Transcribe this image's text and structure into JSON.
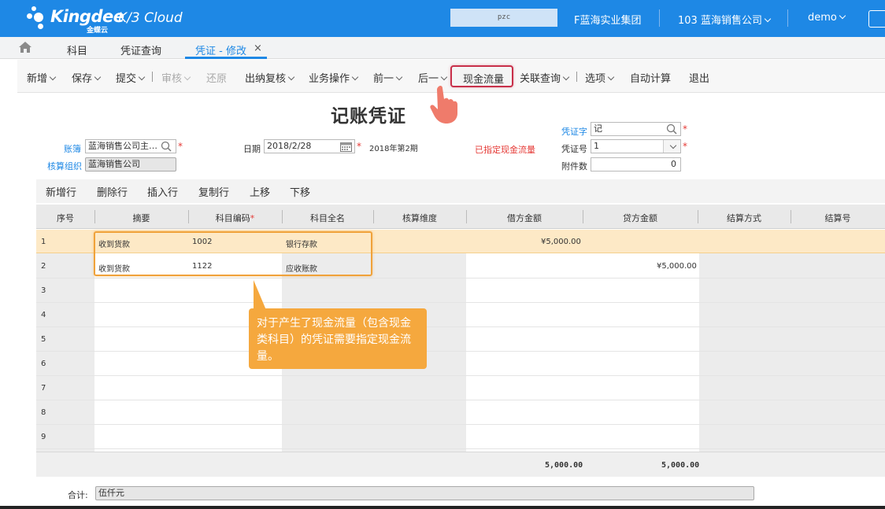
{
  "header": {
    "brand": "Kingdee",
    "brand_sub": "金蝶云",
    "product": "K/3 Cloud",
    "search_value": "pzc",
    "org_group": "F蓝海实业集团",
    "company": "103 蓝海销售公司",
    "user": "demo",
    "color": "#1e88e5"
  },
  "tabs": {
    "items": [
      "科目",
      "凭证查询",
      "凭证 - 修改"
    ],
    "active": "凭证 - 修改",
    "close": "×"
  },
  "toolbar": {
    "new": "新增",
    "save": "保存",
    "submit": "提交",
    "audit": "审核",
    "restore": "还原",
    "cashier_review": "出纳复核",
    "business_ops": "业务操作",
    "prev": "前一",
    "next": "后一",
    "cash_flow": "现金流量",
    "related_query": "关联查询",
    "options": "选项",
    "auto_calc": "自动计算",
    "exit": "退出"
  },
  "form": {
    "title": "记账凭证",
    "book_label": "账簿",
    "book_value": "蓝海销售公司主…",
    "org_label": "核算组织",
    "org_value": "蓝海销售公司",
    "date_label": "日期",
    "date_value": "2018/2/28",
    "period": "2018年第2期",
    "cash_flow_status": "已指定现金流量",
    "voucher_word_label": "凭证字",
    "voucher_word_value": "记",
    "voucher_no_label": "凭证号",
    "voucher_no_value": "1",
    "attachments_label": "附件数",
    "attachments_value": "0",
    "required": "*"
  },
  "grid_toolbar": [
    "新增行",
    "删除行",
    "插入行",
    "复制行",
    "上移",
    "下移"
  ],
  "grid": {
    "columns": [
      "序号",
      "摘要",
      "科目编码",
      "科目全名",
      "核算维度",
      "借方金额",
      "贷方金额",
      "结算方式",
      "结算号"
    ],
    "rows": [
      {
        "no": "1",
        "summary": "收到货款",
        "code": "1002",
        "name": "银行存款",
        "debit": "¥5,000.00",
        "credit": ""
      },
      {
        "no": "2",
        "summary": "收到货款",
        "code": "1122",
        "name": "应收账款",
        "debit": "",
        "credit": "¥5,000.00"
      },
      {
        "no": "3"
      },
      {
        "no": "4"
      },
      {
        "no": "5"
      },
      {
        "no": "6"
      },
      {
        "no": "7"
      },
      {
        "no": "8"
      },
      {
        "no": "9"
      }
    ],
    "total_debit": "5,000.00",
    "total_credit": "5,000.00"
  },
  "tooltip": "对于产生了现金流量（包含现金类科目）的凭证需要指定现金流量。",
  "footer": {
    "total_label": "合计:",
    "total_words": "伍仟元"
  }
}
